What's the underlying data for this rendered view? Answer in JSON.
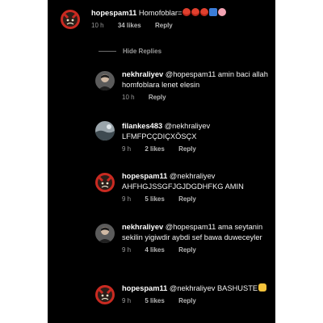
{
  "comments": [
    {
      "username": "hopespam11",
      "text": "Homofoblar=",
      "time": "10 h",
      "likes": "34 likes",
      "reply": "Reply",
      "emojis": [
        "angry-face-emoji",
        "angry-face-emoji",
        "angry-face-emoji",
        "keycap-emoji",
        "brain-emoji"
      ]
    },
    {
      "username": "nekhraliyev",
      "text": "@hopespam11 amin baci allah homfoblara lenet elesin",
      "time": "10 h",
      "reply": "Reply"
    },
    {
      "username": "filankes483",
      "text": "@nekhraliyev LFMFPCÇDIÇXÖSÇX",
      "time": "9 h",
      "likes": "2 likes",
      "reply": "Reply"
    },
    {
      "username": "hopespam11",
      "text": "@nekhraliyev AHFHGJSSGFJGJDGDHFKG AMIN",
      "time": "9 h",
      "likes": "5 likes",
      "reply": "Reply"
    },
    {
      "username": "nekhraliyev",
      "text": "@hopespam11 ama seytanin sekilin yigiwdir aybdi sef bawa duweceyler",
      "time": "9 h",
      "likes": "4 likes",
      "reply": "Reply"
    },
    {
      "username": "hopespam11",
      "text": "@nekhraliyev BASHUSTE",
      "time": "9 h",
      "likes": "5 likes",
      "reply": "Reply",
      "emojis": [
        "raising-hands-emoji"
      ]
    }
  ],
  "hide_replies": "Hide Replies",
  "colors": {
    "background": "#000000",
    "text": "#f2f2f2",
    "muted": "#9a9a9a"
  }
}
